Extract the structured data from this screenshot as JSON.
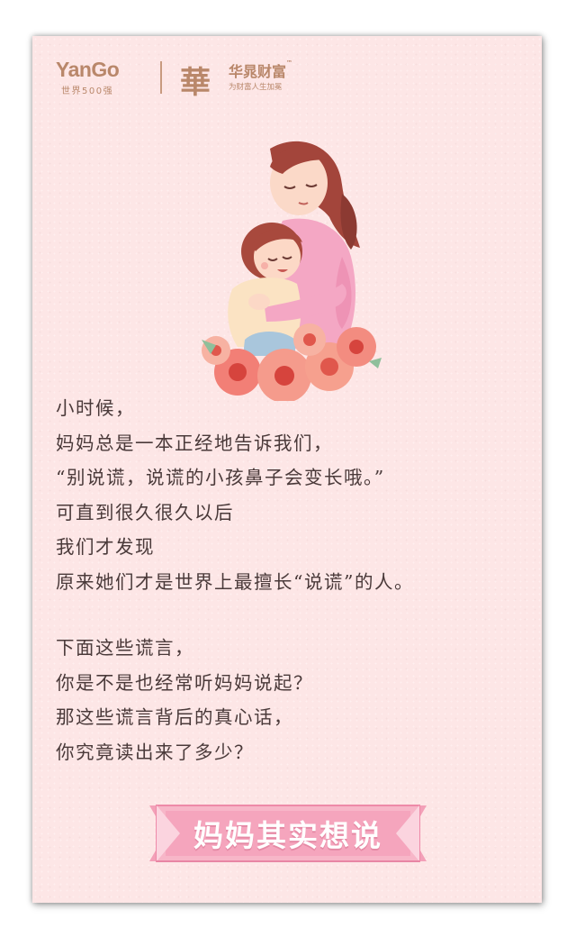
{
  "logos": {
    "yango_text": "YanGo",
    "yango_sub": "世界500强",
    "hua_mark": "華",
    "hua_name": "华晁财富",
    "hua_tm": "™",
    "hua_slogan": "为财富人生加冕"
  },
  "illustration": {
    "icon": "mother-hugging-daughter-with-flowers-illustration"
  },
  "poem": {
    "lines_1": [
      "小时候，",
      "妈妈总是一本正经地告诉我们，",
      "“别说谎，说谎的小孩鼻子会变长哦。”",
      "可直到很久很久以后",
      "我们才发现",
      "原来她们才是世界上最擅长“说谎”的人。"
    ],
    "lines_2": [
      "下面这些谎言，",
      "你是不是也经常听妈妈说起？",
      "那这些谎言背后的真心话，",
      "你究竟读出来了多少？"
    ]
  },
  "cta": {
    "label": "妈妈其实想说"
  },
  "colors": {
    "card_bg": "#fde6e6",
    "text": "#4a3a3a",
    "logo": "#b9876a",
    "button_pink": "#f7a9c0",
    "button_dark": "#ef8faa"
  }
}
